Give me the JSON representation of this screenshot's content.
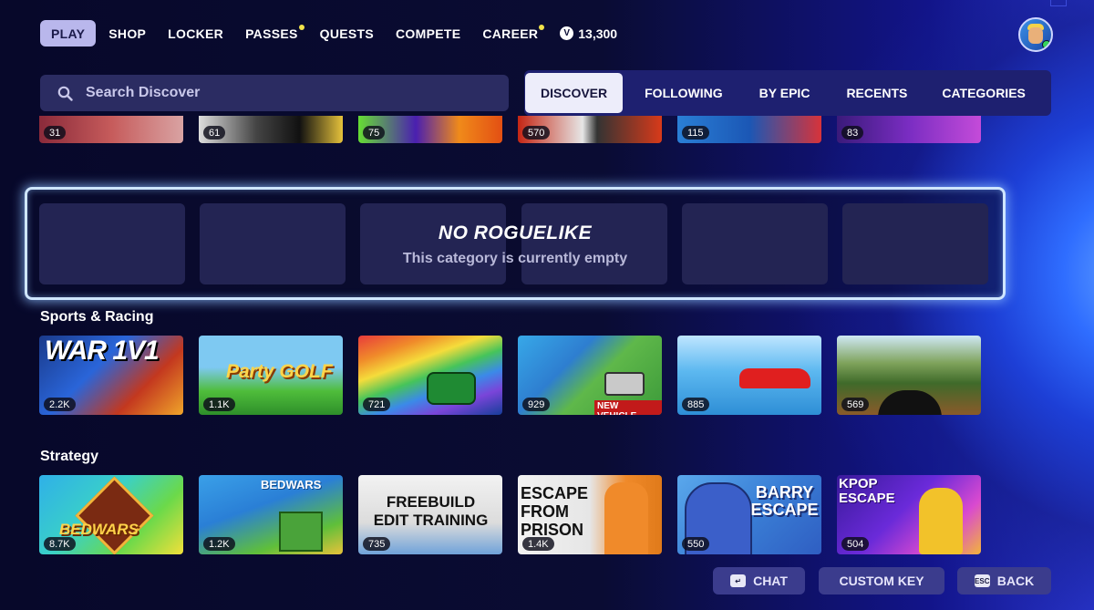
{
  "nav": {
    "items": [
      {
        "label": "PLAY",
        "active": true,
        "dot": false
      },
      {
        "label": "SHOP",
        "active": false,
        "dot": false
      },
      {
        "label": "LOCKER",
        "active": false,
        "dot": false
      },
      {
        "label": "PASSES",
        "active": false,
        "dot": true
      },
      {
        "label": "QUESTS",
        "active": false,
        "dot": false
      },
      {
        "label": "COMPETE",
        "active": false,
        "dot": false
      },
      {
        "label": "CAREER",
        "active": false,
        "dot": true
      }
    ],
    "vbucks_icon": "V",
    "vbucks": "13,300",
    "avatar_icon": "player-avatar"
  },
  "search": {
    "placeholder": "Search Discover",
    "value": ""
  },
  "tabs": [
    "DISCOVER",
    "FOLLOWING",
    "BY EPIC",
    "RECENTS",
    "CATEGORIES"
  ],
  "active_tab": "DISCOVER",
  "top_row_counts": [
    "31",
    "61",
    "75",
    "570",
    "115",
    "83"
  ],
  "empty_category": {
    "title": "NO ROGUELIKE",
    "subtitle": "This category is currently empty"
  },
  "sections": [
    {
      "title": "Sports & Racing",
      "tiles": [
        {
          "count": "2.2K",
          "art": "WAR 1V1"
        },
        {
          "count": "1.1K",
          "art": "Party GOLF"
        },
        {
          "count": "721",
          "art": ""
        },
        {
          "count": "929",
          "art": "NEW VEHICLE"
        },
        {
          "count": "885",
          "art": ""
        },
        {
          "count": "569",
          "art": ""
        }
      ]
    },
    {
      "title": "Strategy",
      "tiles": [
        {
          "count": "8.7K",
          "art": "BEDWARS"
        },
        {
          "count": "1.2K",
          "art": "BEDWARS"
        },
        {
          "count": "735",
          "art": "FREEBUILD EDIT TRAINING"
        },
        {
          "count": "1.4K",
          "art": "ESCAPE FROM PRISON"
        },
        {
          "count": "550",
          "art": "BARRY ESCAPE"
        },
        {
          "count": "504",
          "art": "KPOP ESCAPE"
        }
      ]
    }
  ],
  "bottom": {
    "chat": {
      "key": "↵",
      "label": "CHAT"
    },
    "custom_key": {
      "label": "CUSTOM KEY"
    },
    "back": {
      "key": "ESC",
      "label": "BACK"
    }
  },
  "colors": {
    "accent": "#b9b7ec",
    "background": "#0a0c33",
    "tab_bar": "#1e2070",
    "glow": "#cfe6ff"
  }
}
